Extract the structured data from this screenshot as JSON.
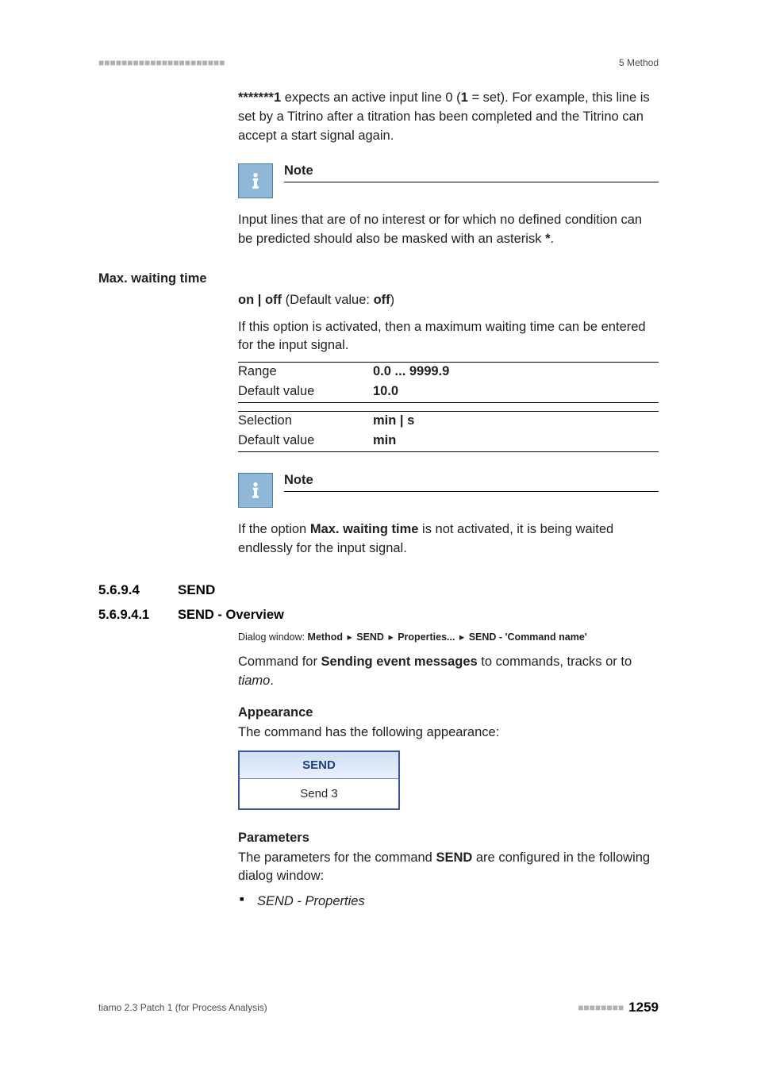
{
  "header": {
    "dashes": "■■■■■■■■■■■■■■■■■■■■■■",
    "section": "5 Method"
  },
  "intro": {
    "pattern": "*******1",
    "text_before": " expects an active input line 0 (",
    "one": "1",
    "text_mid": " = set). For example, this line is set by a Titrino after a titration has been completed and the Titrino can accept a start signal again."
  },
  "note1": {
    "title": "Note",
    "body_before": "Input lines that are of no interest or for which no defined condition can be predicted should also be masked with an asterisk ",
    "star": "*",
    "body_after": "."
  },
  "maxwait": {
    "label": "Max. waiting time",
    "toggle_prefix": "on | off",
    "toggle_suffix_before": " (Default value: ",
    "toggle_default": "off",
    "toggle_suffix_after": ")",
    "desc": "If this option is activated, then a maximum waiting time can be entered for the input signal.",
    "spec1": {
      "k1": "Range",
      "v1": "0.0 ... 9999.9",
      "k2": "Default value",
      "v2": "10.0"
    },
    "spec2": {
      "k1": "Selection",
      "v1": "min | s",
      "k2": "Default value",
      "v2": "min"
    }
  },
  "note2": {
    "title": "Note",
    "body_before": "If the option ",
    "body_bold": "Max. waiting time",
    "body_after": " is not activated, it is being waited endlessly for the input signal."
  },
  "sec_send": {
    "num": "5.6.9.4",
    "title": "SEND"
  },
  "sec_send_ov": {
    "num": "5.6.9.4.1",
    "title": "SEND - Overview",
    "dialog_label": "Dialog window: ",
    "p1": "Method",
    "p2": "SEND",
    "p3": "Properties...",
    "p4": "SEND - 'Command name'",
    "cmd_desc_before": "Command for ",
    "cmd_desc_bold": "Sending event messages",
    "cmd_desc_after_before_ital": " to commands, tracks or to ",
    "cmd_desc_ital": "tiamo",
    "cmd_desc_after": "."
  },
  "appearance": {
    "heading": "Appearance",
    "desc": "The command has the following appearance:",
    "box_top": "SEND",
    "box_bot": "Send 3"
  },
  "parameters": {
    "heading": "Parameters",
    "desc_before": "The parameters for the command ",
    "desc_bold": "SEND",
    "desc_after": " are configured in the following dialog window:",
    "bullet1": "SEND - Properties"
  },
  "footer": {
    "left": "tiamo 2.3 Patch 1 (for Process Analysis)",
    "dashes": "■■■■■■■■",
    "page": "1259"
  }
}
